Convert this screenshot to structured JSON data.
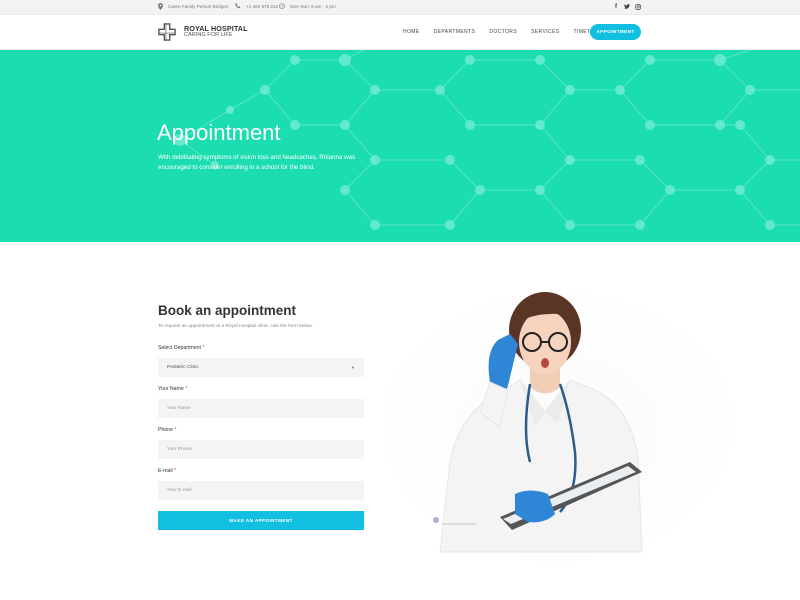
{
  "topbar": {
    "address": "Caren Family Pertum Bridges",
    "phone": "+1 460 978 222",
    "hours": "Mon-Sun: 8 am - 2 pm",
    "social_icons": [
      "facebook-icon",
      "twitter-icon",
      "instagram-icon"
    ]
  },
  "header": {
    "logo_title": "ROYAL HOSPITAL",
    "logo_subtitle": "CARING FOR LIFE",
    "nav": [
      "HOME",
      "DEPARTMENTS",
      "DOCTORS",
      "SERVICES",
      "TIMETABLE"
    ],
    "cta_label": "APPOINTMENT"
  },
  "hero": {
    "title": "Appointment",
    "description": "With debilitating symptoms of vision loss and headcaches, Rhianna was encouraged to consider enrolling in a school for the blind."
  },
  "form": {
    "title": "Book an appointment",
    "intro": "To request an appointment at a Royal Hospital clinic, use the form below.",
    "department_label": "Select Department",
    "department_value": "Pediatric Clinic",
    "name_label": "Your Name",
    "name_placeholder": "Your Name",
    "phone_label": "Phone",
    "phone_placeholder": "Your Phone",
    "email_label": "E-mail",
    "email_placeholder": "Your E-mail",
    "required_mark": "*",
    "submit_label": "MAKE AN APPOINTMENT"
  },
  "colors": {
    "accent": "#12bfe0",
    "hero_bg": "#1cddb0",
    "required": "#e23a3a"
  }
}
